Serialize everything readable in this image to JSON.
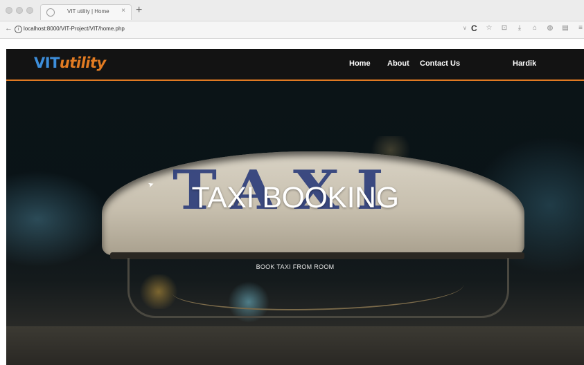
{
  "browser": {
    "tab_title": "VIT utility | Home",
    "tab_close": "×",
    "new_tab": "+",
    "url": "localhost:8000/VIT-Project/VIT/home.php",
    "icons": [
      "back-icon",
      "info-icon",
      "reload-icon",
      "star-icon",
      "lock-icon",
      "download-icon",
      "home-icon",
      "shield-icon",
      "menu-icon"
    ]
  },
  "site": {
    "brand_vit": "VIT",
    "brand_utility": "utility",
    "nav": {
      "home": "Home",
      "about": "About",
      "contact": "Contact Us",
      "user": "Hardik"
    },
    "accent_color": "#e07a23",
    "brand_blue": "#3d8edb"
  },
  "hero": {
    "title": "TAXI BOOKING",
    "subtitle": "BOOK TAXI FROM ROOM",
    "sign_text": "TAXI"
  }
}
